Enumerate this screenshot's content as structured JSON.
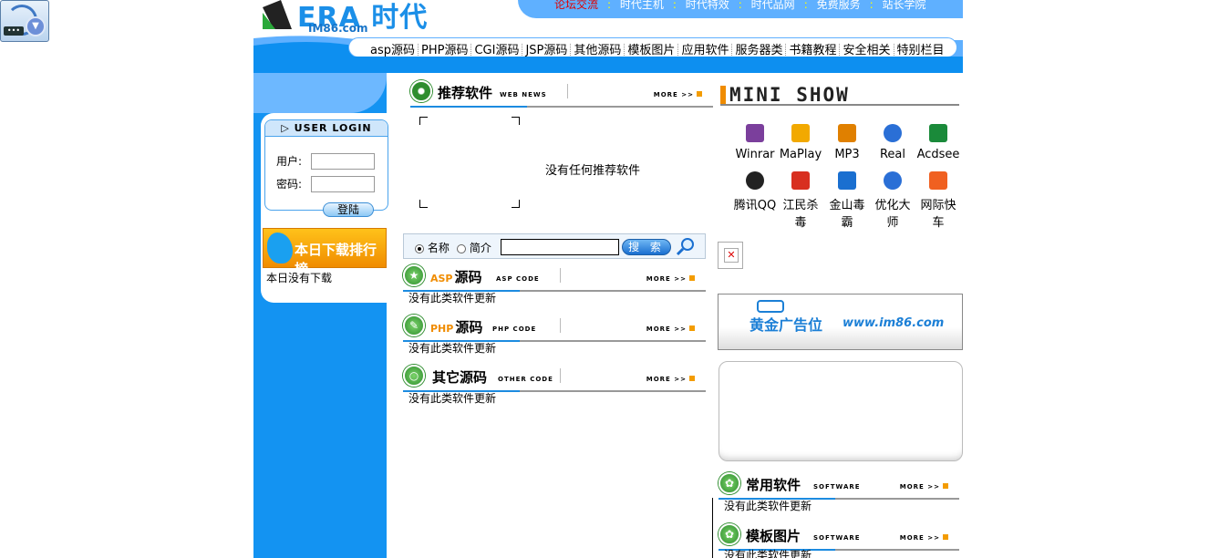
{
  "top_nav": [
    "论坛交流",
    "时代主机",
    "时代特效",
    "时代品网",
    "免费服务",
    "站长学院"
  ],
  "logo": {
    "title": "ERA 时代",
    "sub": "IM86.com"
  },
  "category_nav": [
    "asp源码",
    "PHP源码",
    "CGI源码",
    "JSP源码",
    "其他源码",
    "模板图片",
    "应用软件",
    "服务器类",
    "书籍教程",
    "安全相关",
    "特别栏目"
  ],
  "login": {
    "title": "USER LOGIN",
    "user_label": "用户:",
    "pass_label": "密码:",
    "button": "登陆"
  },
  "rank": {
    "banner": "本日下载排行榜",
    "empty": "本日没有下载"
  },
  "recommend": {
    "title": "推荐软件",
    "sub": "WEB NEWS",
    "more": "MORE >>",
    "empty": "没有任何推荐软件"
  },
  "search": {
    "option_name": "名称",
    "option_desc": "简介",
    "value": "",
    "button": "搜 索"
  },
  "sections": [
    {
      "title_prefix": "ASP",
      "title": "源码",
      "sub": "ASP CODE",
      "more": "MORE >>",
      "empty": "没有此类软件更新"
    },
    {
      "title_prefix": "PHP",
      "title": "源码",
      "sub": "PHP CODE",
      "more": "MORE >>",
      "empty": "没有此类软件更新"
    },
    {
      "title_prefix": "",
      "title": "其它源码",
      "sub": "OTHER CODE",
      "more": "MORE >>",
      "empty": "没有此类软件更新"
    }
  ],
  "mini_show": {
    "title": "MINI SHOW"
  },
  "software": [
    {
      "label": "Winrar",
      "color": "#7b3f9c"
    },
    {
      "label": "MaPlay",
      "color": "#f2a900"
    },
    {
      "label": "MP3",
      "color": "#e08000"
    },
    {
      "label": "Real",
      "color": "#2a6fd6"
    },
    {
      "label": "Acdsee",
      "color": "#1a8a3a"
    },
    {
      "label": "腾讯QQ",
      "color": "#222222"
    },
    {
      "label": "江民杀毒",
      "color": "#d83020"
    },
    {
      "label": "金山毒霸",
      "color": "#1a6fd0"
    },
    {
      "label": "优化大师",
      "color": "#2a6fd6"
    },
    {
      "label": "网际快车",
      "color": "#f06020"
    }
  ],
  "gold_ad": {
    "title": "黄金广告位",
    "url": "www.im86.com"
  },
  "right_sections": [
    {
      "title": "常用软件",
      "sub": "SOFTWARE",
      "more": "MORE >>",
      "empty": "没有此类软件更新"
    },
    {
      "title": "模板图片",
      "sub": "SOFTWARE",
      "more": "MORE >>",
      "empty": "没有此类软件更新"
    }
  ]
}
